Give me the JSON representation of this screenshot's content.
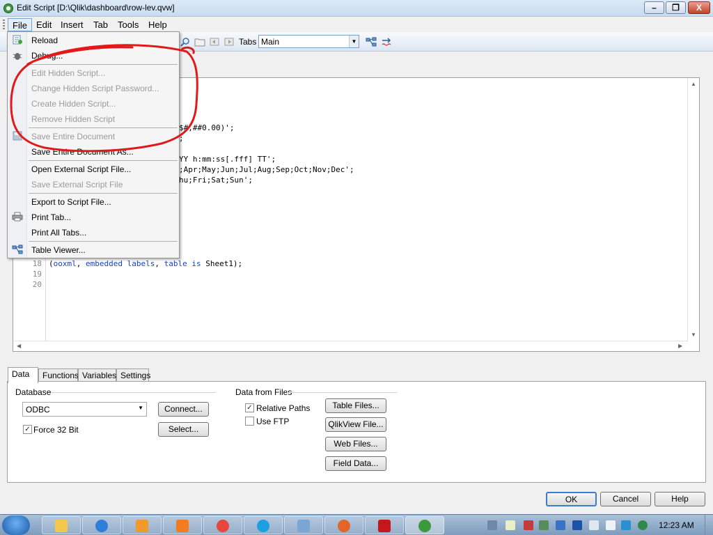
{
  "window": {
    "title": "Edit Script [D:\\Qlik\\dashboard\\row-lev.qvw]",
    "minimize_glyph": "–",
    "maximize_glyph": "❐",
    "close_glyph": "X"
  },
  "menubar": {
    "items": [
      "File",
      "Edit",
      "Insert",
      "Tab",
      "Tools",
      "Help"
    ]
  },
  "toolbar": {
    "tabs_label": "Tabs",
    "tabs_value": "Main",
    "dropdown_arrow": "▼"
  },
  "file_menu": {
    "items": [
      {
        "label": "Reload",
        "enabled": true,
        "icon": "reload-icon"
      },
      {
        "label": "Debug...",
        "enabled": true,
        "icon": "debug-icon"
      },
      {
        "label": "Edit Hidden Script...",
        "enabled": false
      },
      {
        "label": "Change Hidden Script Password...",
        "enabled": false
      },
      {
        "label": "Create Hidden Script...",
        "enabled": false
      },
      {
        "label": "Remove Hidden Script",
        "enabled": false
      },
      {
        "label": "Save Entire Document",
        "enabled": false,
        "icon": "save-icon"
      },
      {
        "label": "Save Entire Document As...",
        "enabled": true
      },
      {
        "label": "Open External Script File...",
        "enabled": true
      },
      {
        "label": "Save External Script File",
        "enabled": false
      },
      {
        "label": "Export to Script File...",
        "enabled": true
      },
      {
        "label": "Print Tab...",
        "enabled": true,
        "icon": "printer-icon"
      },
      {
        "label": "Print All Tabs...",
        "enabled": true
      },
      {
        "label": "Table Viewer...",
        "enabled": true,
        "icon": "table-viewer-icon"
      }
    ]
  },
  "editor": {
    "visible_code": [
      "$#,##0.00)';",
      ";",
      "YY h:mm:ss[.fff] TT';",
      ";Apr;May;Jun;Jul;Aug;Sep;Oct;Nov;Dec';",
      "hu;Fri;Sat;Sun';"
    ],
    "line_18": {
      "number": "18",
      "open": "(",
      "kw1": "ooxml",
      "comma1": ", ",
      "kw2": "embedded labels",
      "comma2": ", ",
      "kw3": "table is",
      "rest": " Sheet1);"
    },
    "line_19": "19",
    "line_20": "20"
  },
  "bottom_tabs": [
    "Data",
    "Functions",
    "Variables",
    "Settings"
  ],
  "data_panel": {
    "database_label": "Database",
    "database_value": "ODBC",
    "connect_label": "Connect...",
    "select_label": "Select...",
    "force32_label": "Force 32 Bit",
    "force32_checked": true,
    "data_from_files_label": "Data from Files",
    "relative_paths_label": "Relative Paths",
    "relative_paths_checked": true,
    "use_ftp_label": "Use FTP",
    "use_ftp_checked": false,
    "table_files_label": "Table Files...",
    "qlikview_file_label": "QlikView File...",
    "web_files_label": "Web Files...",
    "field_data_label": "Field Data...",
    "check_mark": "✓"
  },
  "dialog_buttons": {
    "ok": "OK",
    "cancel": "Cancel",
    "help": "Help"
  },
  "taskbar": {
    "clock": "12:23 AM",
    "apps": [
      "explorer",
      "internet-explorer",
      "media-player",
      "vlc",
      "chrome",
      "skype",
      "remote-desktop",
      "firefox",
      "acrobat",
      "qlikview"
    ]
  },
  "colors": {
    "annotation_red": "#e01a1a",
    "keyword_blue": "#1a3fc4",
    "title_bar": "#c9dcf0"
  }
}
